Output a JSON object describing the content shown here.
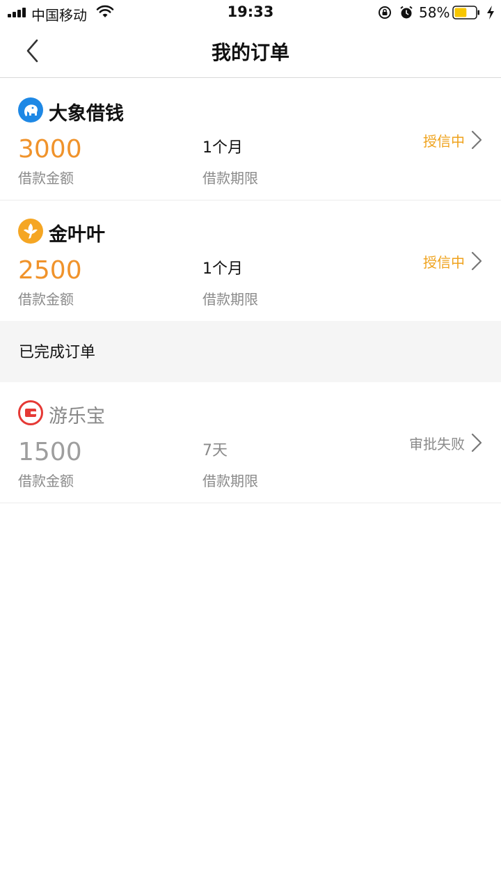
{
  "status_bar": {
    "carrier": "中国移动",
    "time": "19:33",
    "battery_percent": "58%",
    "battery_level": 0.58,
    "icons": [
      "signal-icon",
      "wifi-icon",
      "orientation-lock-icon",
      "alarm-icon",
      "battery-icon",
      "charging-icon"
    ]
  },
  "nav": {
    "title": "我的订单",
    "back_icon": "chevron-left-icon"
  },
  "active_orders": [
    {
      "name": "大象借钱",
      "logo": "elephant-logo-icon",
      "amount": "3000",
      "amount_label": "借款金额",
      "term": "1个月",
      "term_label": "借款期限",
      "status": "授信中",
      "color": "#1e88e5"
    },
    {
      "name": "金叶叶",
      "logo": "gold-leaf-logo-icon",
      "amount": "2500",
      "amount_label": "借款金额",
      "term": "1个月",
      "term_label": "借款期限",
      "status": "授信中",
      "color": "#f5a623"
    }
  ],
  "completed_section": {
    "title": "已完成订单"
  },
  "completed_orders": [
    {
      "name": "游乐宝",
      "logo": "wallet-logo-icon",
      "amount": "1500",
      "amount_label": "借款金额",
      "term": "7天",
      "term_label": "借款期限",
      "status": "审批失败",
      "color": "#e53935"
    }
  ],
  "colors": {
    "amount_accent": "#f0932b",
    "status_accent": "#efa21c",
    "muted_text": "#8a8a8a",
    "section_bg": "#f5f5f5"
  }
}
